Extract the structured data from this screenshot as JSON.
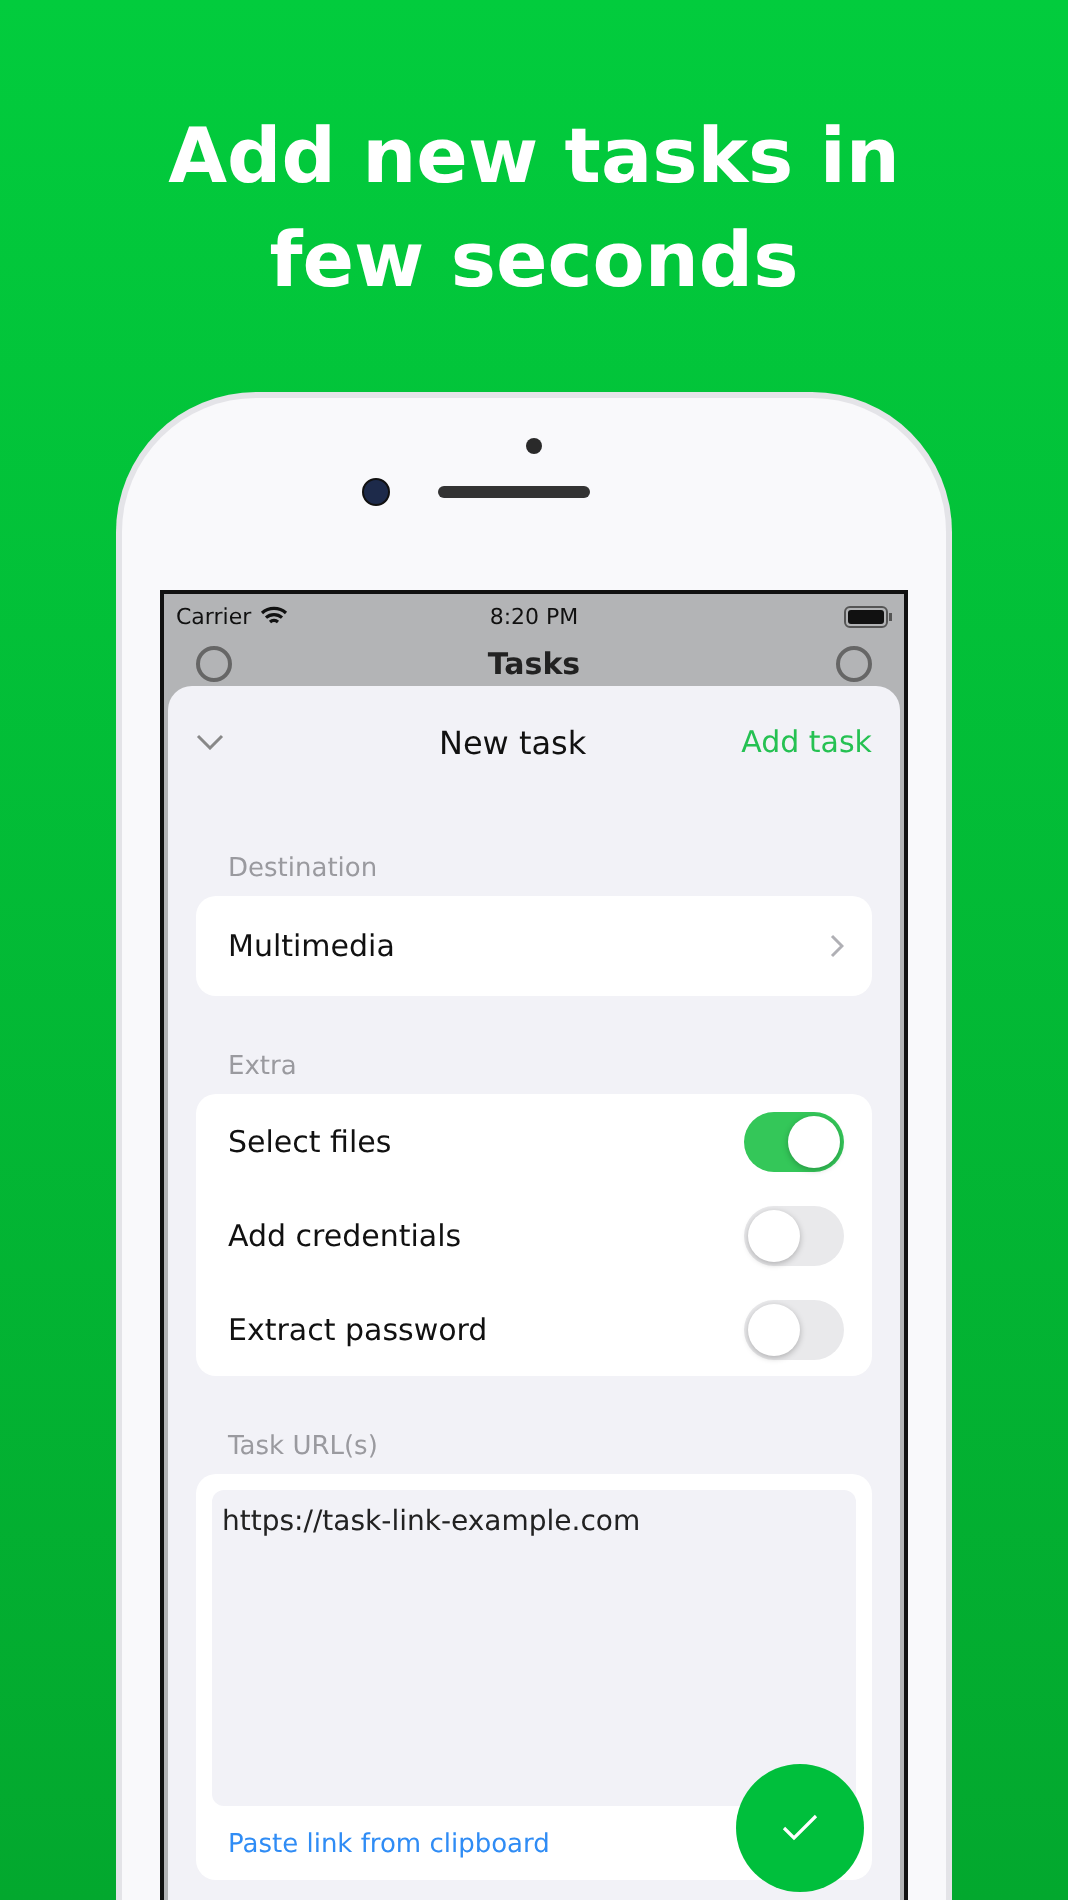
{
  "headline": [
    "Add new tasks in",
    "few seconds"
  ],
  "status_bar": {
    "carrier": "Carrier",
    "time": "8:20 PM"
  },
  "background_nav": {
    "title": "Tasks"
  },
  "sheet": {
    "title": "New task",
    "action": "Add task"
  },
  "destination": {
    "label": "Destination",
    "value": "Multimedia"
  },
  "extra": {
    "label": "Extra",
    "options": [
      {
        "label": "Select files",
        "on": true
      },
      {
        "label": "Add credentials",
        "on": false
      },
      {
        "label": "Extract password",
        "on": false
      }
    ]
  },
  "urls": {
    "label": "Task URL(s)",
    "value": "https://task-link-example.com",
    "paste_link": "Paste link from clipboard"
  }
}
